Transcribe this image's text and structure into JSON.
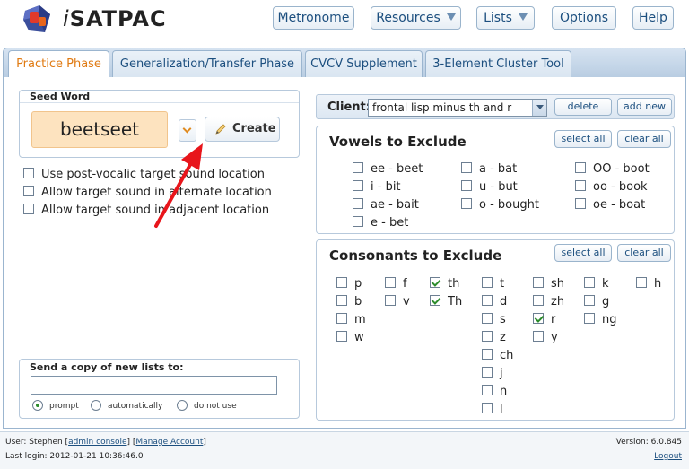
{
  "app": {
    "logo_i": "i",
    "logo_rest": "SATPAC"
  },
  "topnav": {
    "metronome": "Metronome",
    "resources": "Resources",
    "lists": "Lists",
    "options": "Options",
    "help": "Help"
  },
  "tabs": [
    {
      "label": "Practice Phase"
    },
    {
      "label": "Generalization/Transfer Phase"
    },
    {
      "label": "CVCV Supplement"
    },
    {
      "label": "3-Element Cluster Tool"
    }
  ],
  "seed": {
    "title": "Seed Word",
    "word": "beetseet",
    "create_label": "Create"
  },
  "options": [
    {
      "label": "Use post-vocalic target sound location",
      "checked": false
    },
    {
      "label": "Allow target sound in alternate location",
      "checked": false
    },
    {
      "label": "Allow target sound in adjacent location",
      "checked": false
    }
  ],
  "send": {
    "title": "Send a copy of new lists to:",
    "value": "",
    "radios": [
      {
        "label": "prompt",
        "selected": true
      },
      {
        "label": "automatically",
        "selected": false
      },
      {
        "label": "do not use",
        "selected": false
      }
    ]
  },
  "client": {
    "label": "Client:",
    "selected": "frontal lisp minus th and r",
    "delete_label": "delete",
    "add_label": "add new"
  },
  "vowels": {
    "title": "Vowels to Exclude",
    "select_all": "select all",
    "clear_all": "clear all",
    "items": [
      {
        "label": "ee - beet",
        "checked": false
      },
      {
        "label": "i - bit",
        "checked": false
      },
      {
        "label": "ae - bait",
        "checked": false
      },
      {
        "label": "e - bet",
        "checked": false
      },
      {
        "label": "a - bat",
        "checked": false
      },
      {
        "label": "u - but",
        "checked": false
      },
      {
        "label": "o - bought",
        "checked": false
      },
      {
        "label": "OO - boot",
        "checked": false
      },
      {
        "label": "oo - book",
        "checked": false
      },
      {
        "label": "oe - boat",
        "checked": false
      }
    ]
  },
  "consonants": {
    "title": "Consonants to Exclude",
    "select_all": "select all",
    "clear_all": "clear all",
    "items": [
      {
        "label": "p",
        "checked": false
      },
      {
        "label": "b",
        "checked": false
      },
      {
        "label": "m",
        "checked": false
      },
      {
        "label": "w",
        "checked": false
      },
      {
        "label": "f",
        "checked": false
      },
      {
        "label": "v",
        "checked": false
      },
      {
        "label": "th",
        "checked": true
      },
      {
        "label": "Th",
        "checked": true
      },
      {
        "label": "t",
        "checked": false
      },
      {
        "label": "d",
        "checked": false
      },
      {
        "label": "s",
        "checked": false
      },
      {
        "label": "z",
        "checked": false
      },
      {
        "label": "ch",
        "checked": false
      },
      {
        "label": "j",
        "checked": false
      },
      {
        "label": "n",
        "checked": false
      },
      {
        "label": "l",
        "checked": false
      },
      {
        "label": "sh",
        "checked": false
      },
      {
        "label": "zh",
        "checked": false
      },
      {
        "label": "r",
        "checked": true
      },
      {
        "label": "y",
        "checked": false
      },
      {
        "label": "k",
        "checked": false
      },
      {
        "label": "g",
        "checked": false
      },
      {
        "label": "ng",
        "checked": false
      },
      {
        "label": "h",
        "checked": false
      }
    ]
  },
  "footer": {
    "user_prefix": "User: Stephen [",
    "admin_console": "admin console",
    "mid": "] [",
    "manage_account": "Manage Account",
    "end": "]",
    "last_login": "Last login: 2012-01-21 10:36:46.0",
    "version": "Version: 6.0.845",
    "logout": "Logout"
  },
  "colors": {
    "accent": "#e07a12",
    "link": "#1c4f7f",
    "seed_bg": "#fde3bf",
    "arrow": "#e8151b"
  }
}
